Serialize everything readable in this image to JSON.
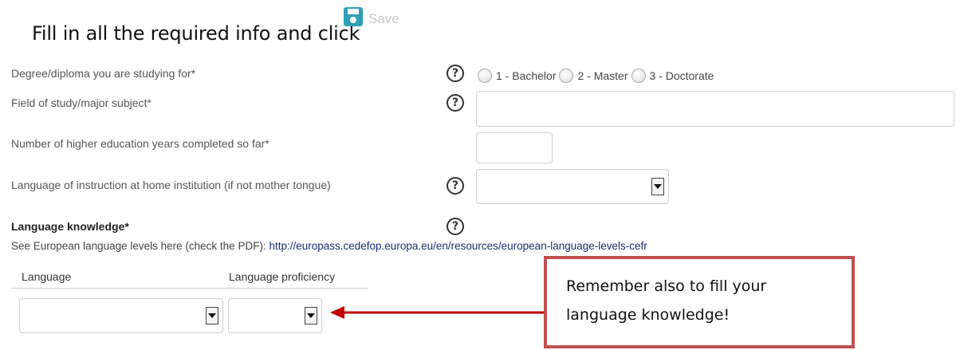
{
  "intro": {
    "text": "Fill in all the required info and click"
  },
  "save_button": {
    "label": "Save",
    "icon": "save-icon"
  },
  "form": {
    "degree": {
      "label": "Degree/diploma you are studying for*",
      "options": [
        "1 - Bachelor",
        "2 - Master",
        "3 - Doctorate"
      ]
    },
    "field_of_study": {
      "label": "Field of study/major subject*",
      "value": ""
    },
    "years_completed": {
      "label": "Number of higher education years completed so far*",
      "value": ""
    },
    "instruction_language": {
      "label": "Language of instruction at home institution (if not mother tongue)",
      "selected": ""
    },
    "language_knowledge": {
      "label": "Language knowledge*",
      "hint_prefix": "See European language levels here (check the PDF): ",
      "hint_link": "http://europass.cedefop.europa.eu/en/resources/european-language-levels-cefr",
      "columns": [
        "Language",
        "Language proficiency"
      ],
      "language_selected": "",
      "proficiency_selected": ""
    }
  },
  "help_icon_glyph": "?",
  "callout": {
    "text": "Remember also to fill your language knowledge!"
  },
  "colors": {
    "arrow": "#c00000",
    "callout_border": "#c0504d",
    "save_icon": "#2ea1b8"
  }
}
